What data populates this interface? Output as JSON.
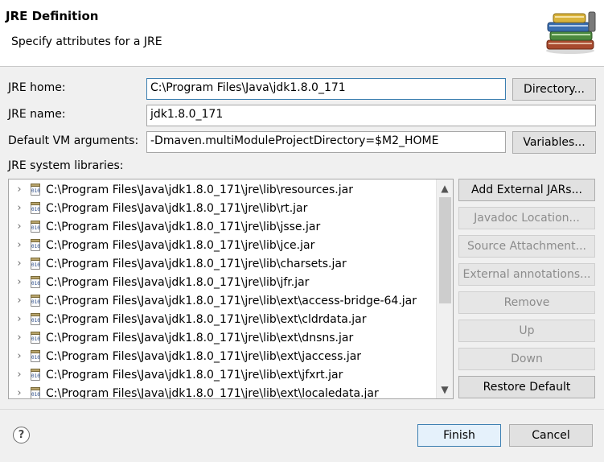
{
  "header": {
    "title": "JRE Definition",
    "description": "Specify attributes for a JRE",
    "icon": "library-books-icon"
  },
  "form": {
    "jre_home": {
      "label": "JRE home:",
      "value": "C:\\Program Files\\Java\\jdk1.8.0_171",
      "button": "Directory..."
    },
    "jre_name": {
      "label": "JRE name:",
      "value": "jdk1.8.0_171"
    },
    "vm_args": {
      "label": "Default VM arguments:",
      "value": "-Dmaven.multiModuleProjectDirectory=$M2_HOME",
      "button": "Variables..."
    }
  },
  "libraries": {
    "label": "JRE system libraries:",
    "items": [
      "C:\\Program Files\\Java\\jdk1.8.0_171\\jre\\lib\\resources.jar",
      "C:\\Program Files\\Java\\jdk1.8.0_171\\jre\\lib\\rt.jar",
      "C:\\Program Files\\Java\\jdk1.8.0_171\\jre\\lib\\jsse.jar",
      "C:\\Program Files\\Java\\jdk1.8.0_171\\jre\\lib\\jce.jar",
      "C:\\Program Files\\Java\\jdk1.8.0_171\\jre\\lib\\charsets.jar",
      "C:\\Program Files\\Java\\jdk1.8.0_171\\jre\\lib\\jfr.jar",
      "C:\\Program Files\\Java\\jdk1.8.0_171\\jre\\lib\\ext\\access-bridge-64.jar",
      "C:\\Program Files\\Java\\jdk1.8.0_171\\jre\\lib\\ext\\cldrdata.jar",
      "C:\\Program Files\\Java\\jdk1.8.0_171\\jre\\lib\\ext\\dnsns.jar",
      "C:\\Program Files\\Java\\jdk1.8.0_171\\jre\\lib\\ext\\jaccess.jar",
      "C:\\Program Files\\Java\\jdk1.8.0_171\\jre\\lib\\ext\\jfxrt.jar",
      "C:\\Program Files\\Java\\jdk1.8.0_171\\jre\\lib\\ext\\localedata.jar"
    ],
    "buttons": {
      "add_external": "Add External JARs...",
      "javadoc": "Javadoc Location...",
      "source": "Source Attachment...",
      "annotations": "External annotations...",
      "remove": "Remove",
      "up": "Up",
      "down": "Down",
      "restore": "Restore Default"
    }
  },
  "footer": {
    "help": "?",
    "finish": "Finish",
    "cancel": "Cancel"
  },
  "colors": {
    "focus_border": "#3c7fb1",
    "disabled_text": "#8c8c8c"
  }
}
